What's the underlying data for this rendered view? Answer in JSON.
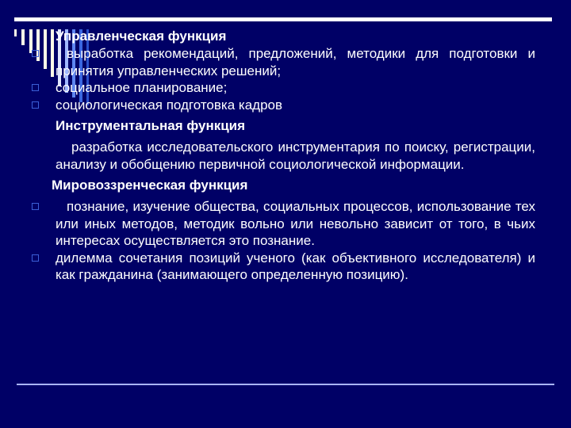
{
  "slide": {
    "colors": {
      "background": "#000066",
      "text": "#ffffff",
      "bullet": "#3b5fd6",
      "top_rule": "#ffffff",
      "bottom_rule": "#a8b4ff"
    },
    "sections": [
      {
        "heading": "Управленческая функция",
        "items": [
          {
            "bullet": true,
            "text": "выработка рекомендаций, предложений, методики для подготовки и принятия управленческих решений;"
          },
          {
            "bullet": true,
            "text": "социальное планирование;"
          },
          {
            "bullet": true,
            "text": "социологическая подготовка кадров"
          }
        ]
      },
      {
        "heading": "Инструментальная функция",
        "items": [
          {
            "bullet": false,
            "text": "разработка исследовательского инструментария по поиску, регистрации, анализу и обобщению первичной социологической информации."
          }
        ]
      },
      {
        "heading": "Мировоззренческая функция",
        "items": [
          {
            "bullet": true,
            "text": "познание, изучение общества, социальных процессов, использование тех или иных методов, методик вольно или невольно зависит от того, в чьих интересах осуществляется это познание."
          },
          {
            "bullet": true,
            "text": "дилемма сочетания позиций ученого (как объективного исследователя) и как гражданина (занимающего определенную позицию)."
          }
        ]
      }
    ]
  }
}
